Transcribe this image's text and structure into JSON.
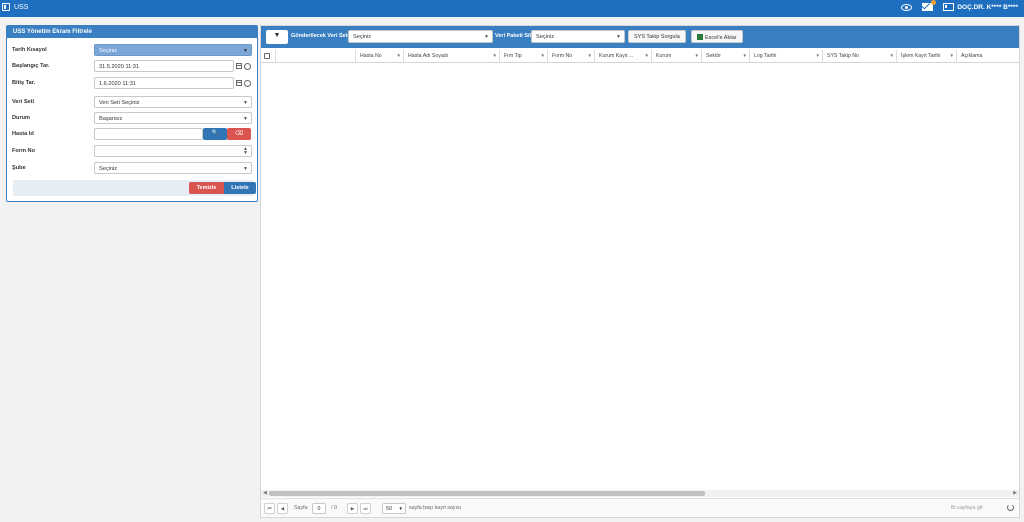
{
  "app": {
    "title": "USS"
  },
  "topbar": {
    "user_name": "DOÇ.DR. K**** B****"
  },
  "filter_panel": {
    "title": "USS Yönetim Ekranı Filtrele",
    "tarih_kisayol": {
      "label": "Tarih Kısayol",
      "value": "Seçiniz"
    },
    "baslangic": {
      "label": "Başlangıç Tar.",
      "value": "31.5.2020 11:31"
    },
    "bitis": {
      "label": "Bitiş Tar.",
      "value": "1.6.2020 11:31"
    },
    "veri_seti": {
      "label": "Veri Seti",
      "value": "Veri Seti Seçiniz"
    },
    "durum": {
      "label": "Durum",
      "value": "Başarısız"
    },
    "hasta_id": {
      "label": "Hasta Id",
      "value": ""
    },
    "form_no": {
      "label": "Form No",
      "value": ""
    },
    "sube": {
      "label": "Şube",
      "value": "Seçiniz"
    },
    "temizle_label": "Temizle",
    "listele_label": "Listele"
  },
  "toolbar": {
    "gonderilecek_label": "Gönderilecek Veri Seti",
    "gonderilecek_value": "Seçiniz",
    "veri_paketi_label": "Veri Paketi Sil",
    "veri_paketi_value": "Seçiniz",
    "sys_takip_label": "SYS Takip Sorgula",
    "excel_label": "Excel'e Aktar"
  },
  "grid": {
    "columns": [
      "Hasta No",
      "Hasta Adı Soyadı",
      "Frm Tip",
      "Form No",
      "Kurum Kayıt ...",
      "Kurum",
      "Sektör",
      "Log Tarihi",
      "SYS Takip No",
      "İşlem Kayıt Tarihi",
      "Açıklama"
    ]
  },
  "pager": {
    "page_label": "Sayfa",
    "page_value": "0",
    "of_text": "/ 0",
    "page_size": "50",
    "page_size_label": "sayfa başı kayıt sayısı",
    "empty_text": "Bi sayfaya git"
  }
}
